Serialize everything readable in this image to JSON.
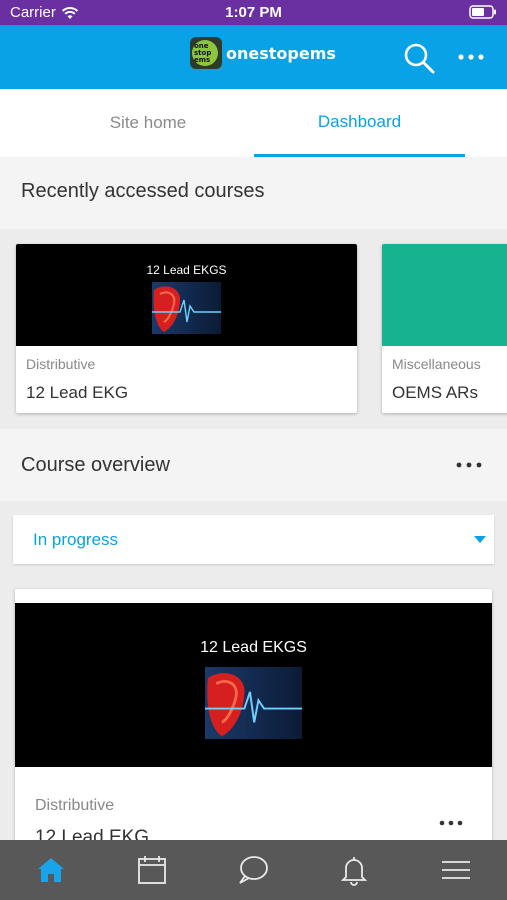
{
  "status_bar": {
    "carrier": "Carrier",
    "time": "1:07 PM"
  },
  "header": {
    "logo_text": "onestopems",
    "logo_badge_text": [
      "one",
      "stop",
      "ems"
    ]
  },
  "tabs": [
    {
      "label": "Site home",
      "active": false
    },
    {
      "label": "Dashboard",
      "active": true
    }
  ],
  "recent": {
    "title": "Recently accessed courses",
    "courses": [
      {
        "image_title": "12 Lead EKGS",
        "category": "Distributive",
        "name": "12 Lead EKG"
      },
      {
        "category": "Miscellaneous",
        "name": "OEMS ARs"
      }
    ]
  },
  "overview": {
    "title": "Course overview",
    "filter": {
      "value": "In progress"
    },
    "course": {
      "image_title": "12 Lead EKGS",
      "category": "Distributive",
      "name": "12 Lead EKG"
    }
  },
  "tabbar": [
    {
      "icon": "home-icon",
      "active": true
    },
    {
      "icon": "calendar-icon",
      "active": false
    },
    {
      "icon": "messages-icon",
      "active": false
    },
    {
      "icon": "notifications-icon",
      "active": false
    },
    {
      "icon": "menu-icon",
      "active": false
    }
  ],
  "colors": {
    "accent": "#0aa2e6",
    "status_bar": "#6a2fa0",
    "tabbar": "#585858",
    "teal_card": "#17b391"
  }
}
